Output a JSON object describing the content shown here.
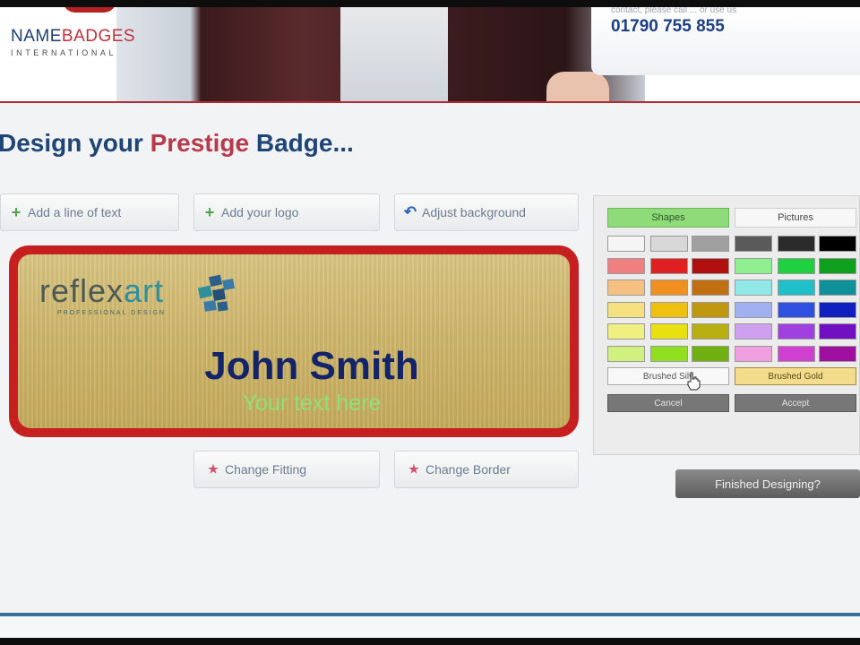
{
  "header": {
    "logo": {
      "name_a": "NAME",
      "name_b": "BADGES",
      "sub": "INTERNATIONAL"
    },
    "contact": {
      "line": "contact, please call ... or use us",
      "phone": "01790 755 855"
    }
  },
  "title": {
    "part1": "Design your",
    "accent": "Prestige",
    "part2": "Badge..."
  },
  "actions": {
    "add_text": "Add a line of text",
    "add_logo": "Add your logo",
    "adjust_bg": "Adjust background",
    "change_fitting": "Change Fitting",
    "change_border": "Change Border"
  },
  "badge": {
    "logo_a": "reflex",
    "logo_b": "art",
    "logo_tag": "PROFESSIONAL DESIGN",
    "name": "John Smith",
    "line2": "Your text here",
    "border_color": "#c51f1f"
  },
  "panel": {
    "tab_shapes": "Shapes",
    "tab_pictures": "Pictures",
    "brushed_silver": "Brushed Silv",
    "brushed_gold": "Brushed Gold",
    "cancel": "Cancel",
    "accept": "Accept",
    "swatches": [
      [
        "#f5f5f5",
        "#d8d8d8",
        "#a0a0a0",
        "#5a5a5a",
        "#2b2b2b",
        "#000000"
      ],
      [
        "#f08080",
        "#e02020",
        "#b01010",
        "#90f090",
        "#20d040",
        "#10a020"
      ],
      [
        "#f5c080",
        "#f09020",
        "#c07010",
        "#90e8e8",
        "#20c0c8",
        "#109098"
      ],
      [
        "#f5e080",
        "#f0c010",
        "#c09810",
        "#a0b0f0",
        "#3050e0",
        "#1020c0"
      ],
      [
        "#f0f080",
        "#e8e010",
        "#b8b010",
        "#d0a0f0",
        "#a040e0",
        "#7010c0"
      ],
      [
        "#d0f080",
        "#90e020",
        "#70b010",
        "#f0a0e0",
        "#d040d0",
        "#a010a0"
      ]
    ]
  },
  "finished": "Finished Designing?"
}
